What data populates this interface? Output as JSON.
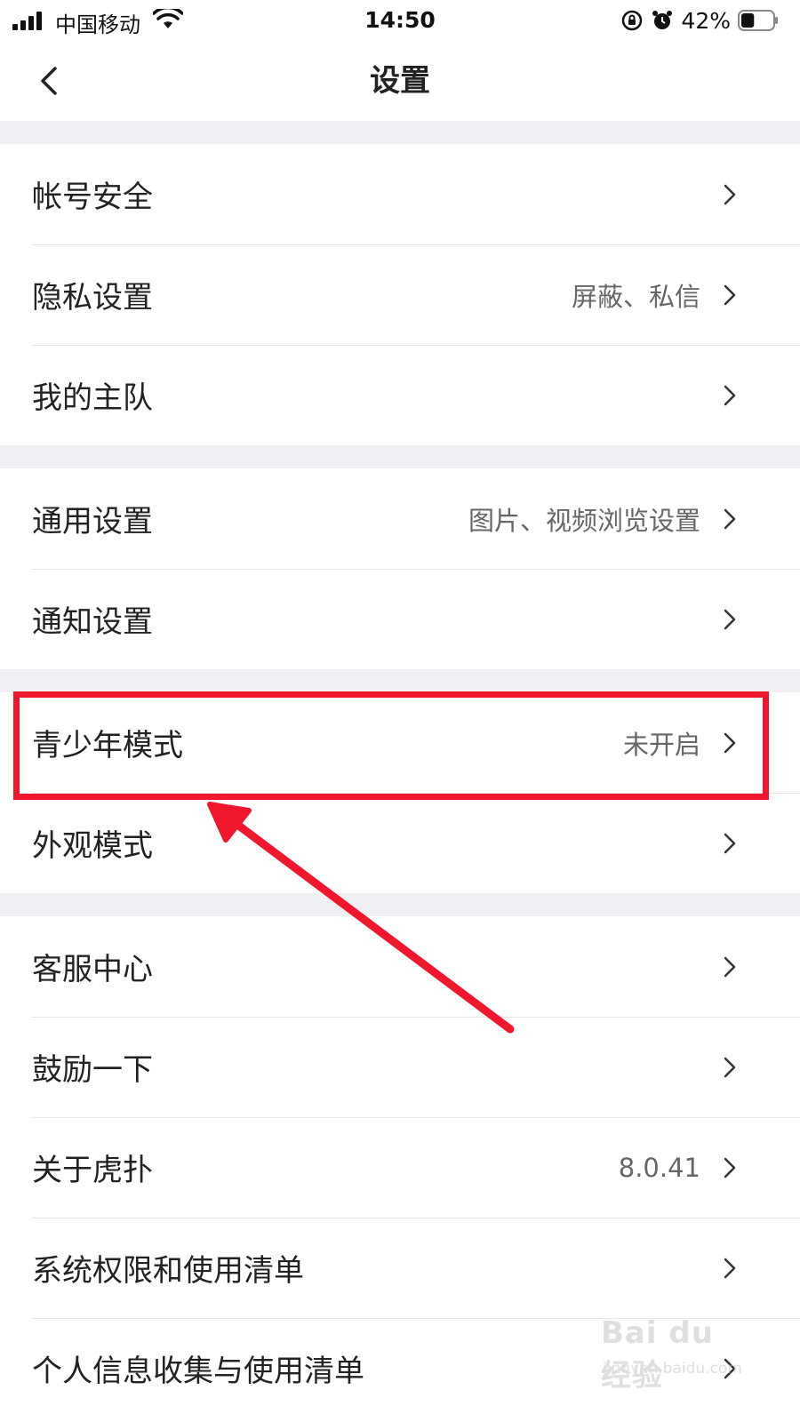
{
  "status_bar": {
    "carrier": "中国移动",
    "time": "14:50",
    "battery_percent": "42%",
    "battery_level": 0.42,
    "icons": [
      "signal-icon",
      "wifi-icon",
      "orientation-lock-icon",
      "alarm-icon",
      "battery-icon"
    ]
  },
  "nav": {
    "title": "设置",
    "back_icon": "chevron-left-icon"
  },
  "groups": [
    {
      "items": [
        {
          "label": "帐号安全",
          "value": ""
        },
        {
          "label": "隐私设置",
          "value": "屏蔽、私信"
        },
        {
          "label": "我的主队",
          "value": ""
        }
      ]
    },
    {
      "items": [
        {
          "label": "通用设置",
          "value": "图片、视频浏览设置"
        },
        {
          "label": "通知设置",
          "value": ""
        }
      ]
    },
    {
      "items": [
        {
          "label": "青少年模式",
          "value": "未开启"
        },
        {
          "label": "外观模式",
          "value": ""
        }
      ]
    },
    {
      "items": [
        {
          "label": "客服中心",
          "value": ""
        },
        {
          "label": "鼓励一下",
          "value": ""
        },
        {
          "label": "关于虎扑",
          "value": "8.0.41"
        },
        {
          "label": "系统权限和使用清单",
          "value": ""
        },
        {
          "label": "个人信息收集与使用清单",
          "value": ""
        }
      ]
    }
  ],
  "annotation": {
    "highlight_color": "#f0162b",
    "highlighted_item": "青少年模式"
  },
  "watermark": {
    "line1": "Bai du 经验",
    "line2": "jingyan.baidu.com"
  },
  "colors": {
    "background_gap": "#f0f0f4",
    "text_primary": "#222222",
    "text_secondary": "#666666",
    "divider": "#e6e6e6"
  }
}
